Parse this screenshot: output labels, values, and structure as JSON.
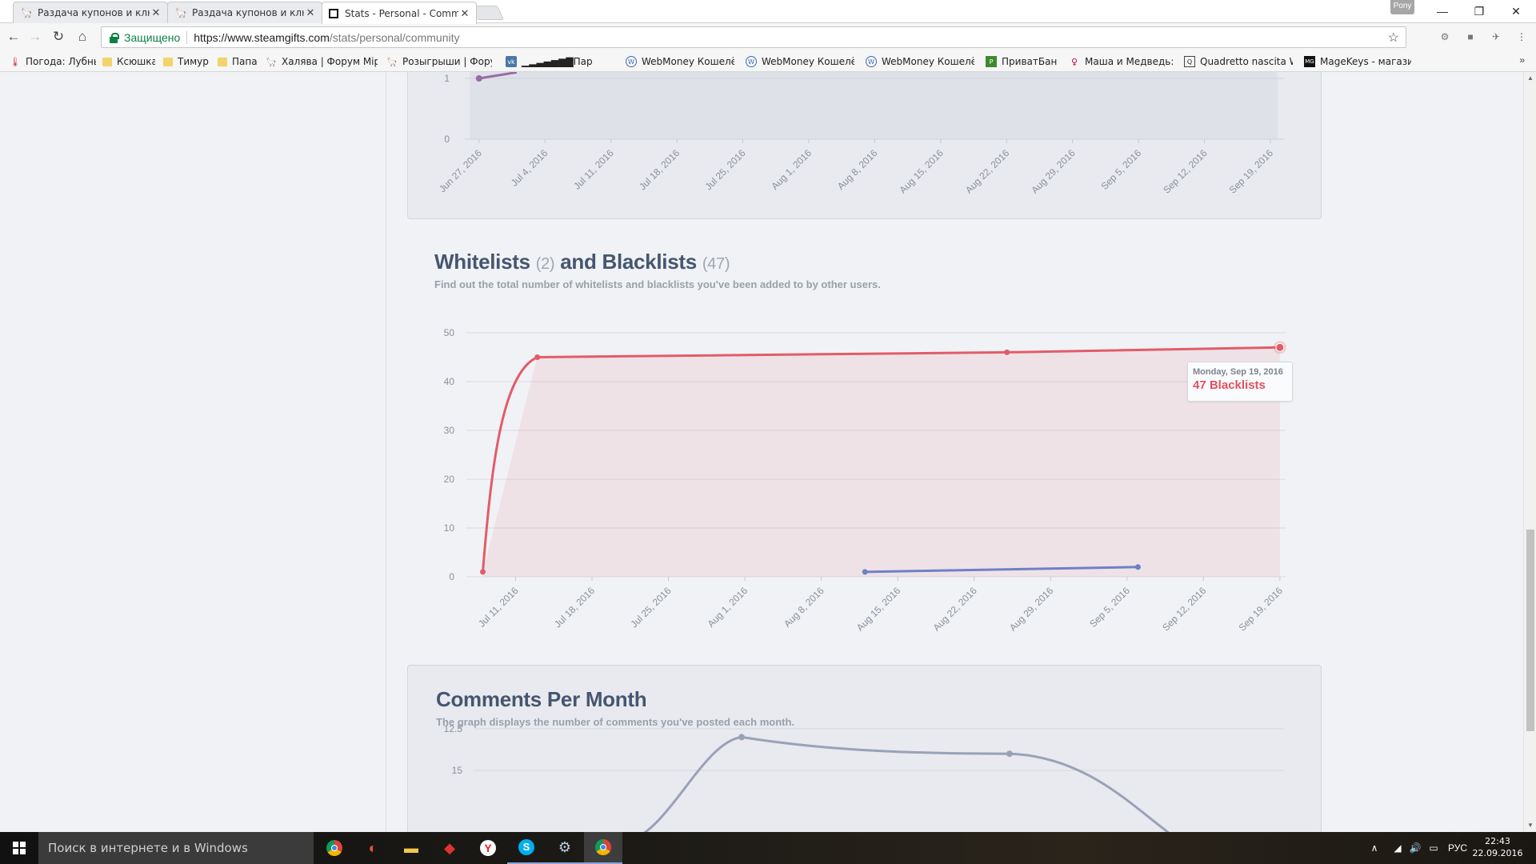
{
  "browser": {
    "tabs": [
      {
        "title": "Раздача купонов и клю",
        "active": false
      },
      {
        "title": "Раздача купонов и клю",
        "active": false
      },
      {
        "title": "Stats - Personal - Comm",
        "active": true
      }
    ],
    "profile": "Pony",
    "secure_label": "Защищено",
    "url_host": "https://www.steamgifts.com",
    "url_path": "/stats/personal/community",
    "bookmarks": [
      {
        "label": "Погода: Лубны",
        "icon": "thermometer-icon"
      },
      {
        "label": "Ксюшка",
        "icon": "folder-icon"
      },
      {
        "label": "Тимур",
        "icon": "folder-icon"
      },
      {
        "label": "Папа",
        "icon": "folder-icon"
      },
      {
        "label": "Халява | Форум Мiре",
        "icon": "forum-icon"
      },
      {
        "label": "Розыгрыши | Форум",
        "icon": "forum-icon"
      },
      {
        "label": "▁▂▃▄▅▆▇Пар",
        "icon": "vk-icon"
      },
      {
        "label": "WebMoney Кошелёк",
        "icon": "globe-icon"
      },
      {
        "label": "WebMoney Кошелёк",
        "icon": "globe-icon"
      },
      {
        "label": "WebMoney Кошелёк",
        "icon": "globe-icon"
      },
      {
        "label": "ПриватБанк",
        "icon": "privatbank-icon"
      },
      {
        "label": "Маша и Медведь: М",
        "icon": "pin-icon"
      },
      {
        "label": "Quadretto nascita Wi",
        "icon": "frame-icon"
      },
      {
        "label": "MageKeys - магазин",
        "icon": "mg-icon"
      }
    ],
    "bookmarks_more": "»"
  },
  "top_chart": {
    "y_ticks": [
      "1",
      "0"
    ],
    "x_ticks": [
      "Jun 27, 2016",
      "Jul 4, 2016",
      "Jul 11, 2016",
      "Jul 18, 2016",
      "Jul 25, 2016",
      "Aug 1, 2016",
      "Aug 8, 2016",
      "Aug 15, 2016",
      "Aug 22, 2016",
      "Aug 29, 2016",
      "Sep 5, 2016",
      "Sep 12, 2016",
      "Sep 19, 2016"
    ]
  },
  "whitelists": {
    "title_a": "Whitelists",
    "count_a": "(2)",
    "title_b": "and Blacklists",
    "count_b": "(47)",
    "description": "Find out the total number of whitelists and blacklists you've been added to by other users.",
    "tooltip_date": "Monday, Sep 19, 2016",
    "tooltip_value": "47 Blacklists"
  },
  "comments": {
    "title": "Comments Per Month",
    "description": "The graph displays the number of comments you've posted each month.",
    "y_ticks": [
      "15",
      "12.5"
    ]
  },
  "chart_data": [
    {
      "type": "line",
      "title": "",
      "x": [
        "Jun 27, 2016",
        "Jul 1, 2016"
      ],
      "series": [
        {
          "values": [
            1,
            1.1
          ]
        }
      ],
      "ylim": [
        0,
        1
      ],
      "x_ticks": [
        "Jun 27, 2016",
        "Jul 4, 2016",
        "Jul 11, 2016",
        "Jul 18, 2016",
        "Jul 25, 2016",
        "Aug 1, 2016",
        "Aug 8, 2016",
        "Aug 15, 2016",
        "Aug 22, 2016",
        "Aug 29, 2016",
        "Sep 5, 2016",
        "Sep 12, 2016",
        "Sep 19, 2016"
      ],
      "grid": true
    },
    {
      "type": "area",
      "title": "Whitelists (2) and Blacklists (47)",
      "x_ticks": [
        "Jul 11, 2016",
        "Jul 18, 2016",
        "Jul 25, 2016",
        "Aug 1, 2016",
        "Aug 8, 2016",
        "Aug 15, 2016",
        "Aug 22, 2016",
        "Aug 29, 2016",
        "Sep 5, 2016",
        "Sep 12, 2016",
        "Sep 19, 2016"
      ],
      "y_ticks": [
        0,
        10,
        20,
        30,
        40,
        50
      ],
      "ylim": [
        0,
        50
      ],
      "grid": true,
      "series": [
        {
          "name": "Blacklists",
          "color": "#e25c68",
          "points": [
            [
              "Jul 8, 2016",
              1
            ],
            [
              "Jul 13, 2016",
              45
            ],
            [
              "Aug 25, 2016",
              46
            ],
            [
              "Sep 19, 2016",
              47
            ]
          ]
        },
        {
          "name": "Whitelists",
          "color": "#6f80c6",
          "points": [
            [
              "Aug 12, 2016",
              1
            ],
            [
              "Sep 6, 2016",
              2
            ]
          ]
        }
      ]
    },
    {
      "type": "line",
      "title": "Comments Per Month",
      "y_ticks": [
        15,
        12.5
      ],
      "grid": true,
      "series": [
        {
          "color": "#9aa1b8",
          "values": [
            13,
            14
          ]
        }
      ]
    }
  ]
}
